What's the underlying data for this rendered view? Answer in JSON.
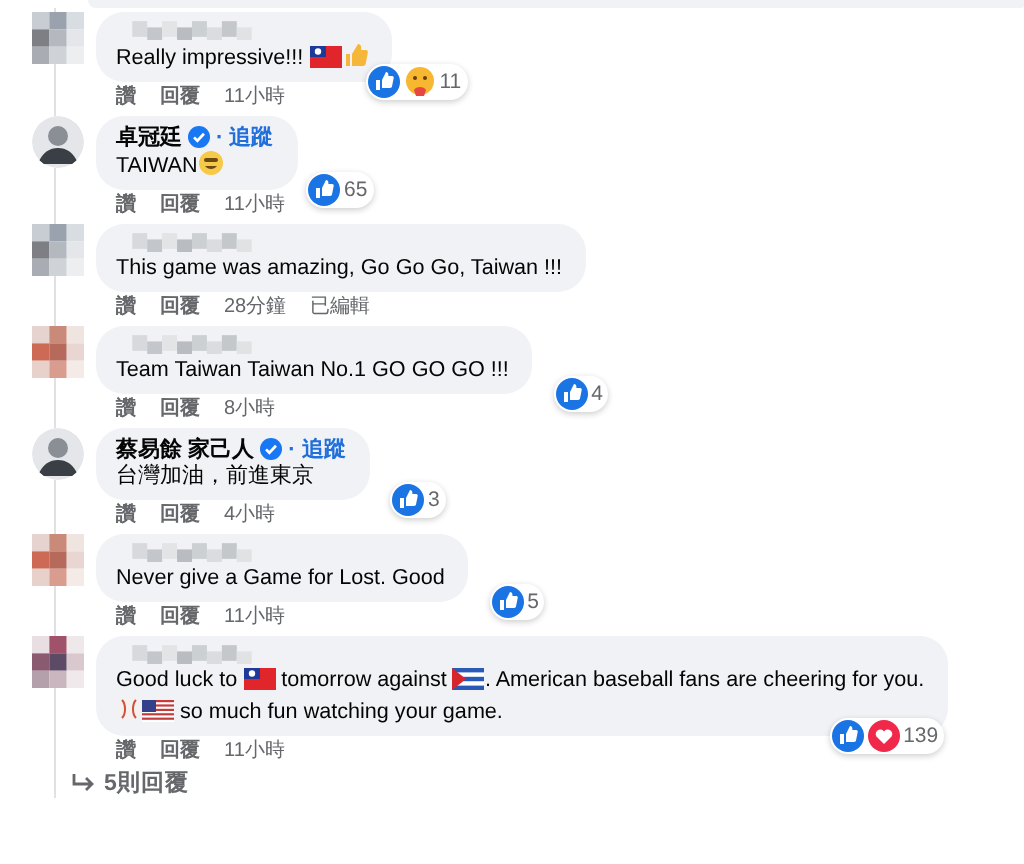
{
  "comments": [
    {
      "avatar": {
        "kind": "mosaic"
      },
      "body": [
        {
          "kind": "text",
          "text": "Really impressive!!! "
        },
        {
          "kind": "flag-taiwan"
        },
        {
          "kind": "thumb"
        }
      ],
      "reactions": {
        "icons": [
          {
            "kind": "like"
          },
          {
            "kind": "care"
          }
        ],
        "count": "11"
      },
      "actions": [
        "讚",
        "回覆",
        "11小時"
      ]
    },
    {
      "avatar": {
        "kind": "person"
      },
      "name": "卓冠廷",
      "verified": true,
      "follow": "· 追蹤",
      "body": [
        {
          "kind": "text",
          "text": "TAIWAN"
        },
        {
          "kind": "grin"
        }
      ],
      "reactions": {
        "icons": [
          {
            "kind": "like"
          }
        ],
        "count": "65"
      },
      "actions": [
        "讚",
        "回覆",
        "11小時"
      ]
    },
    {
      "avatar": {
        "kind": "mosaic"
      },
      "body": [
        {
          "kind": "text",
          "text": "This game was amazing, Go Go Go, Taiwan !!!"
        }
      ],
      "actions": [
        "讚",
        "回覆",
        "28分鐘",
        "已編輯"
      ]
    },
    {
      "avatar": {
        "kind": "mosaic-warm"
      },
      "body": [
        {
          "kind": "text",
          "text": "Team Taiwan Taiwan No.1 GO GO GO !!!"
        }
      ],
      "reactions": {
        "icons": [
          {
            "kind": "like"
          }
        ],
        "count": "4"
      },
      "actions": [
        "讚",
        "回覆",
        "8小時"
      ]
    },
    {
      "avatar": {
        "kind": "person"
      },
      "name": "蔡易餘 家己人",
      "verified": true,
      "follow": "· 追蹤",
      "body": [
        {
          "kind": "text",
          "text": "台灣加油，前進東京"
        }
      ],
      "reactions": {
        "icons": [
          {
            "kind": "like"
          }
        ],
        "count": "3"
      },
      "actions": [
        "讚",
        "回覆",
        "4小時"
      ]
    },
    {
      "avatar": {
        "kind": "mosaic-warm"
      },
      "body": [
        {
          "kind": "text",
          "text": "Never give a Game for Lost. Good"
        }
      ],
      "reactions": {
        "icons": [
          {
            "kind": "like"
          }
        ],
        "count": "5"
      },
      "actions": [
        "讚",
        "回覆",
        "11小時"
      ]
    },
    {
      "avatar": {
        "kind": "mosaic-purple"
      },
      "body": [
        {
          "kind": "text",
          "text": "Good luck to "
        },
        {
          "kind": "flag-taiwan"
        },
        {
          "kind": "text",
          "text": " tomorrow against "
        },
        {
          "kind": "flag-cuba"
        },
        {
          "kind": "text",
          "text": ". American baseball fans are cheering for you."
        },
        {
          "kind": "break"
        },
        {
          "kind": "baseball"
        },
        {
          "kind": "flag-usa"
        },
        {
          "kind": "text",
          "text": " so much fun watching your game."
        }
      ],
      "reactions": {
        "icons": [
          {
            "kind": "like"
          },
          {
            "kind": "love"
          }
        ],
        "count": "139"
      },
      "actions": [
        "讚",
        "回覆",
        "11小時"
      ]
    }
  ],
  "replies_link": "5則回覆"
}
